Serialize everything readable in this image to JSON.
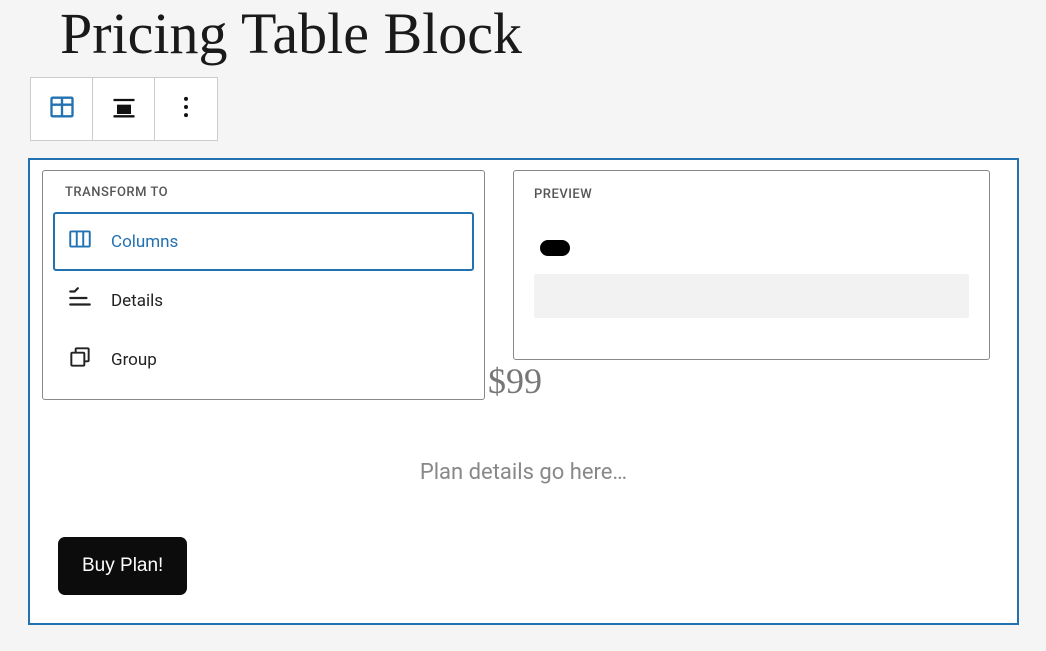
{
  "page_title": "Pricing Table Block",
  "toolbar": {
    "block_type_icon": "pricing-table-icon",
    "align_icon": "align-icon",
    "more_icon": "more-vertical-icon"
  },
  "transform_panel": {
    "header": "TRANSFORM TO",
    "options": [
      {
        "label": "Columns",
        "icon": "columns-icon",
        "active": true
      },
      {
        "label": "Details",
        "icon": "details-icon",
        "active": false
      },
      {
        "label": "Group",
        "icon": "group-icon",
        "active": false
      }
    ]
  },
  "preview_panel": {
    "header": "PREVIEW"
  },
  "block_content": {
    "price": "$99",
    "details_placeholder": "Plan details go here…",
    "button_label": "Buy Plan!"
  }
}
